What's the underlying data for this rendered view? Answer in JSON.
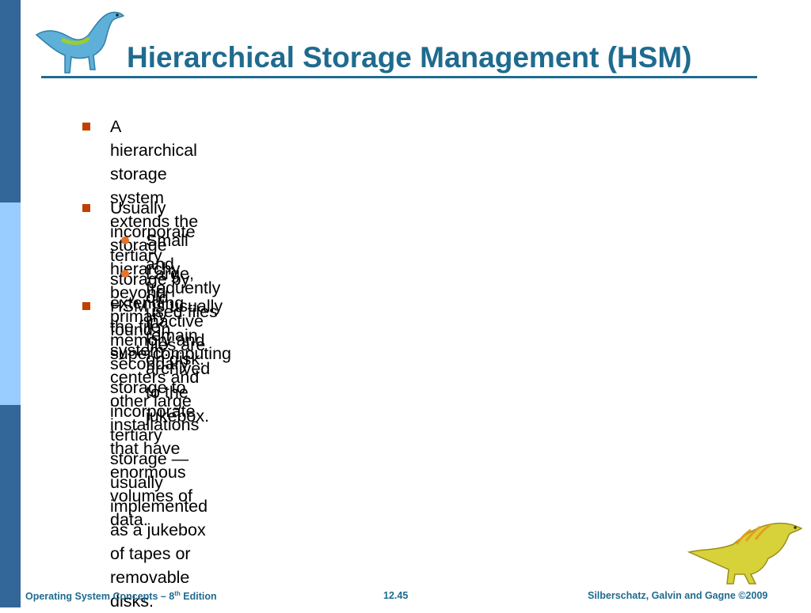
{
  "slide": {
    "title": "Hierarchical Storage Management (HSM)",
    "bullets": [
      {
        "level": 1,
        "lines": [
          "A hierarchical storage system extends the storage hierarchy beyond",
          "primary memory and secondary storage to incorporate tertiary storage —",
          "usually implemented as a jukebox of tapes or removable disks."
        ]
      },
      {
        "level": 1,
        "lines": [
          "Usually incorporate tertiary storage by extending the file system."
        ]
      },
      {
        "level": 2,
        "lines": [
          "Small and frequently used files remain on disk."
        ]
      },
      {
        "level": 2,
        "lines": [
          "Large, old, inactive files are archived to the jukebox."
        ]
      },
      {
        "level": 1,
        "lines": [
          "HSM is usually found in supercomputing centers and other large",
          "installations that have enormous volumes of data."
        ]
      }
    ]
  },
  "footer": {
    "course_prefix": "Operating System Concepts – 8",
    "course_sup": "th",
    "course_suffix": " Edition",
    "page": "12.45",
    "copyright": "Silberschatz, Galvin and Gagne ©2009"
  },
  "colors": {
    "title": "#1f6b8f",
    "stripe_dark": "#336699",
    "stripe_light": "#99ccff",
    "bullet_square": "#c04000",
    "bullet_dot": "#e8732a"
  },
  "icons": {
    "top_left": "dinosaur-logo-icon",
    "bottom_right": "dinosaur-logo-icon"
  }
}
